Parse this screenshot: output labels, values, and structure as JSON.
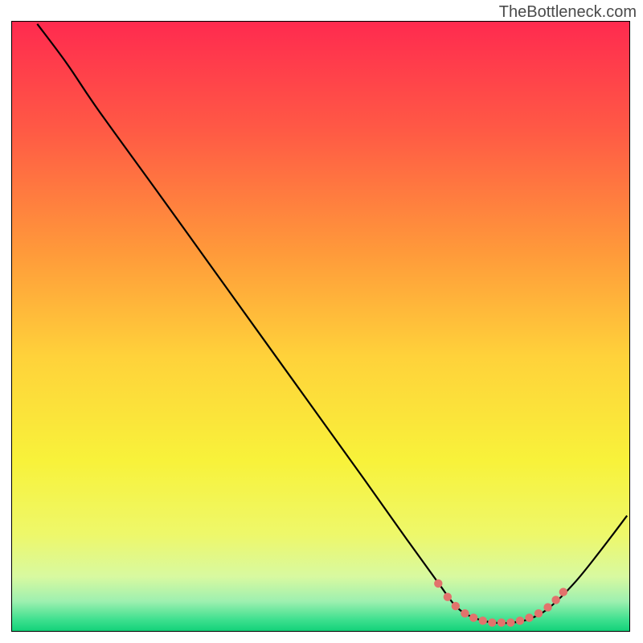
{
  "watermark": "TheBottleneck.com",
  "chart_data": {
    "type": "line",
    "title": "",
    "xlabel": "",
    "ylabel": "",
    "xlim": [
      0,
      100
    ],
    "ylim": [
      0,
      100
    ],
    "gradient_stops": [
      {
        "offset": 0,
        "color": "#ff2a4f"
      },
      {
        "offset": 18,
        "color": "#ff5a45"
      },
      {
        "offset": 38,
        "color": "#ff9a3a"
      },
      {
        "offset": 55,
        "color": "#ffd23a"
      },
      {
        "offset": 72,
        "color": "#f8f23a"
      },
      {
        "offset": 84,
        "color": "#eef86a"
      },
      {
        "offset": 91,
        "color": "#d8f9a0"
      },
      {
        "offset": 95,
        "color": "#9ef0b0"
      },
      {
        "offset": 98,
        "color": "#3fe08f"
      },
      {
        "offset": 100,
        "color": "#10d078"
      }
    ],
    "series": [
      {
        "name": "curve",
        "color": "#000000",
        "points": [
          {
            "x": 4.2,
            "y": 99.5
          },
          {
            "x": 9.0,
            "y": 93.0
          },
          {
            "x": 14.0,
            "y": 85.5
          },
          {
            "x": 24.0,
            "y": 71.5
          },
          {
            "x": 35.0,
            "y": 56.0
          },
          {
            "x": 46.0,
            "y": 40.5
          },
          {
            "x": 57.0,
            "y": 25.0
          },
          {
            "x": 64.0,
            "y": 15.0
          },
          {
            "x": 69.0,
            "y": 8.0
          },
          {
            "x": 72.0,
            "y": 4.0
          },
          {
            "x": 75.0,
            "y": 2.2
          },
          {
            "x": 78.0,
            "y": 1.5
          },
          {
            "x": 81.0,
            "y": 1.5
          },
          {
            "x": 84.0,
            "y": 2.2
          },
          {
            "x": 87.0,
            "y": 4.0
          },
          {
            "x": 91.0,
            "y": 8.0
          },
          {
            "x": 95.0,
            "y": 13.0
          },
          {
            "x": 99.5,
            "y": 19.0
          }
        ]
      },
      {
        "name": "highlight-dots",
        "color": "#e2736c",
        "points": [
          {
            "x": 69.0,
            "y": 7.9
          },
          {
            "x": 70.5,
            "y": 5.7
          },
          {
            "x": 71.8,
            "y": 4.2
          },
          {
            "x": 73.3,
            "y": 3.0
          },
          {
            "x": 74.7,
            "y": 2.3
          },
          {
            "x": 76.2,
            "y": 1.8
          },
          {
            "x": 77.7,
            "y": 1.5
          },
          {
            "x": 79.2,
            "y": 1.5
          },
          {
            "x": 80.7,
            "y": 1.5
          },
          {
            "x": 82.2,
            "y": 1.8
          },
          {
            "x": 83.7,
            "y": 2.3
          },
          {
            "x": 85.2,
            "y": 3.0
          },
          {
            "x": 86.7,
            "y": 4.0
          },
          {
            "x": 88.0,
            "y": 5.2
          },
          {
            "x": 89.2,
            "y": 6.5
          }
        ]
      }
    ]
  }
}
